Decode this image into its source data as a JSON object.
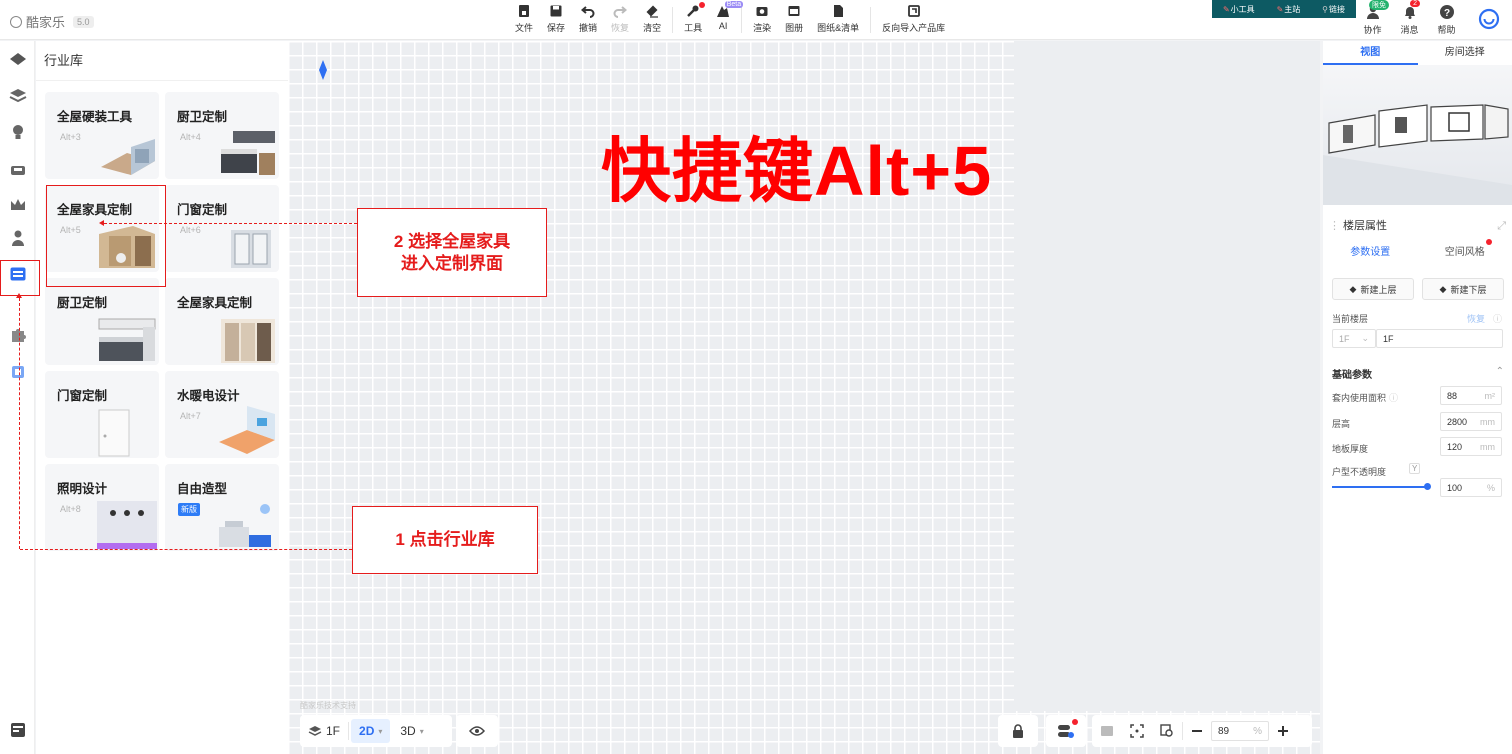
{
  "app": {
    "name": "酷家乐",
    "version": "5.0"
  },
  "toolbar": {
    "items": [
      "文件",
      "保存",
      "撤销",
      "恢复",
      "清空",
      "工具",
      "AI",
      "渲染",
      "图册",
      "图纸&清单",
      "反向导入产品库"
    ],
    "ai_badge": "Beta"
  },
  "links": {
    "tool": "小工具",
    "site": "主站",
    "link": "链接"
  },
  "right_tools": {
    "collab": "协作",
    "collab_badge": "限免",
    "msg": "消息",
    "msg_badge": "2",
    "help": "帮助"
  },
  "panel": {
    "title": "行业库",
    "cards": [
      {
        "name": "全屋硬装工具",
        "shortcut": "Alt+3"
      },
      {
        "name": "厨卫定制",
        "shortcut": "Alt+4"
      },
      {
        "name": "全屋家具定制",
        "shortcut": "Alt+5"
      },
      {
        "name": "门窗定制",
        "shortcut": "Alt+6"
      },
      {
        "name": "厨卫定制",
        "shortcut": ""
      },
      {
        "name": "全屋家具定制",
        "shortcut": ""
      },
      {
        "name": "门窗定制",
        "shortcut": ""
      },
      {
        "name": "水暖电设计",
        "shortcut": "Alt+7"
      },
      {
        "name": "照明设计",
        "shortcut": "Alt+8"
      },
      {
        "name": "自由造型",
        "shortcut": "",
        "tag": "新版"
      }
    ]
  },
  "canvas": {
    "hint": "快捷键Alt+5",
    "callout_2": "2  选择全屋家具\n进入定制界面",
    "callout_1": "1  点击行业库",
    "watermark": "酷家乐技术支持"
  },
  "bottom": {
    "floor": "1F",
    "mode_2d": "2D",
    "mode_3d": "3D",
    "zoom": "89",
    "zoom_unit": "%"
  },
  "right_panel": {
    "tab_view": "视图",
    "tab_room": "房间选择",
    "floor_title": "楼层属性",
    "sub_params": "参数设置",
    "sub_style": "空间风格",
    "btn_up": "新建上层",
    "btn_down": "新建下层",
    "current_floor_label": "当前楼层",
    "restore": "恢复",
    "floor_select": "1F",
    "floor_name": "1F",
    "basic_params": "基础参数",
    "area_label": "套内使用面积",
    "area_value": "88",
    "area_unit": "m²",
    "height_label": "层高",
    "height_value": "2800",
    "height_unit": "mm",
    "thick_label": "地板厚度",
    "thick_value": "120",
    "thick_unit": "mm",
    "opacity_label": "户型不透明度",
    "opacity_value": "100",
    "opacity_unit": "%",
    "opacity_fraction": 0.92
  },
  "colors": {
    "accent": "#2e6ff2",
    "annotation": "#e51c1c",
    "hint": "#ff0000"
  }
}
